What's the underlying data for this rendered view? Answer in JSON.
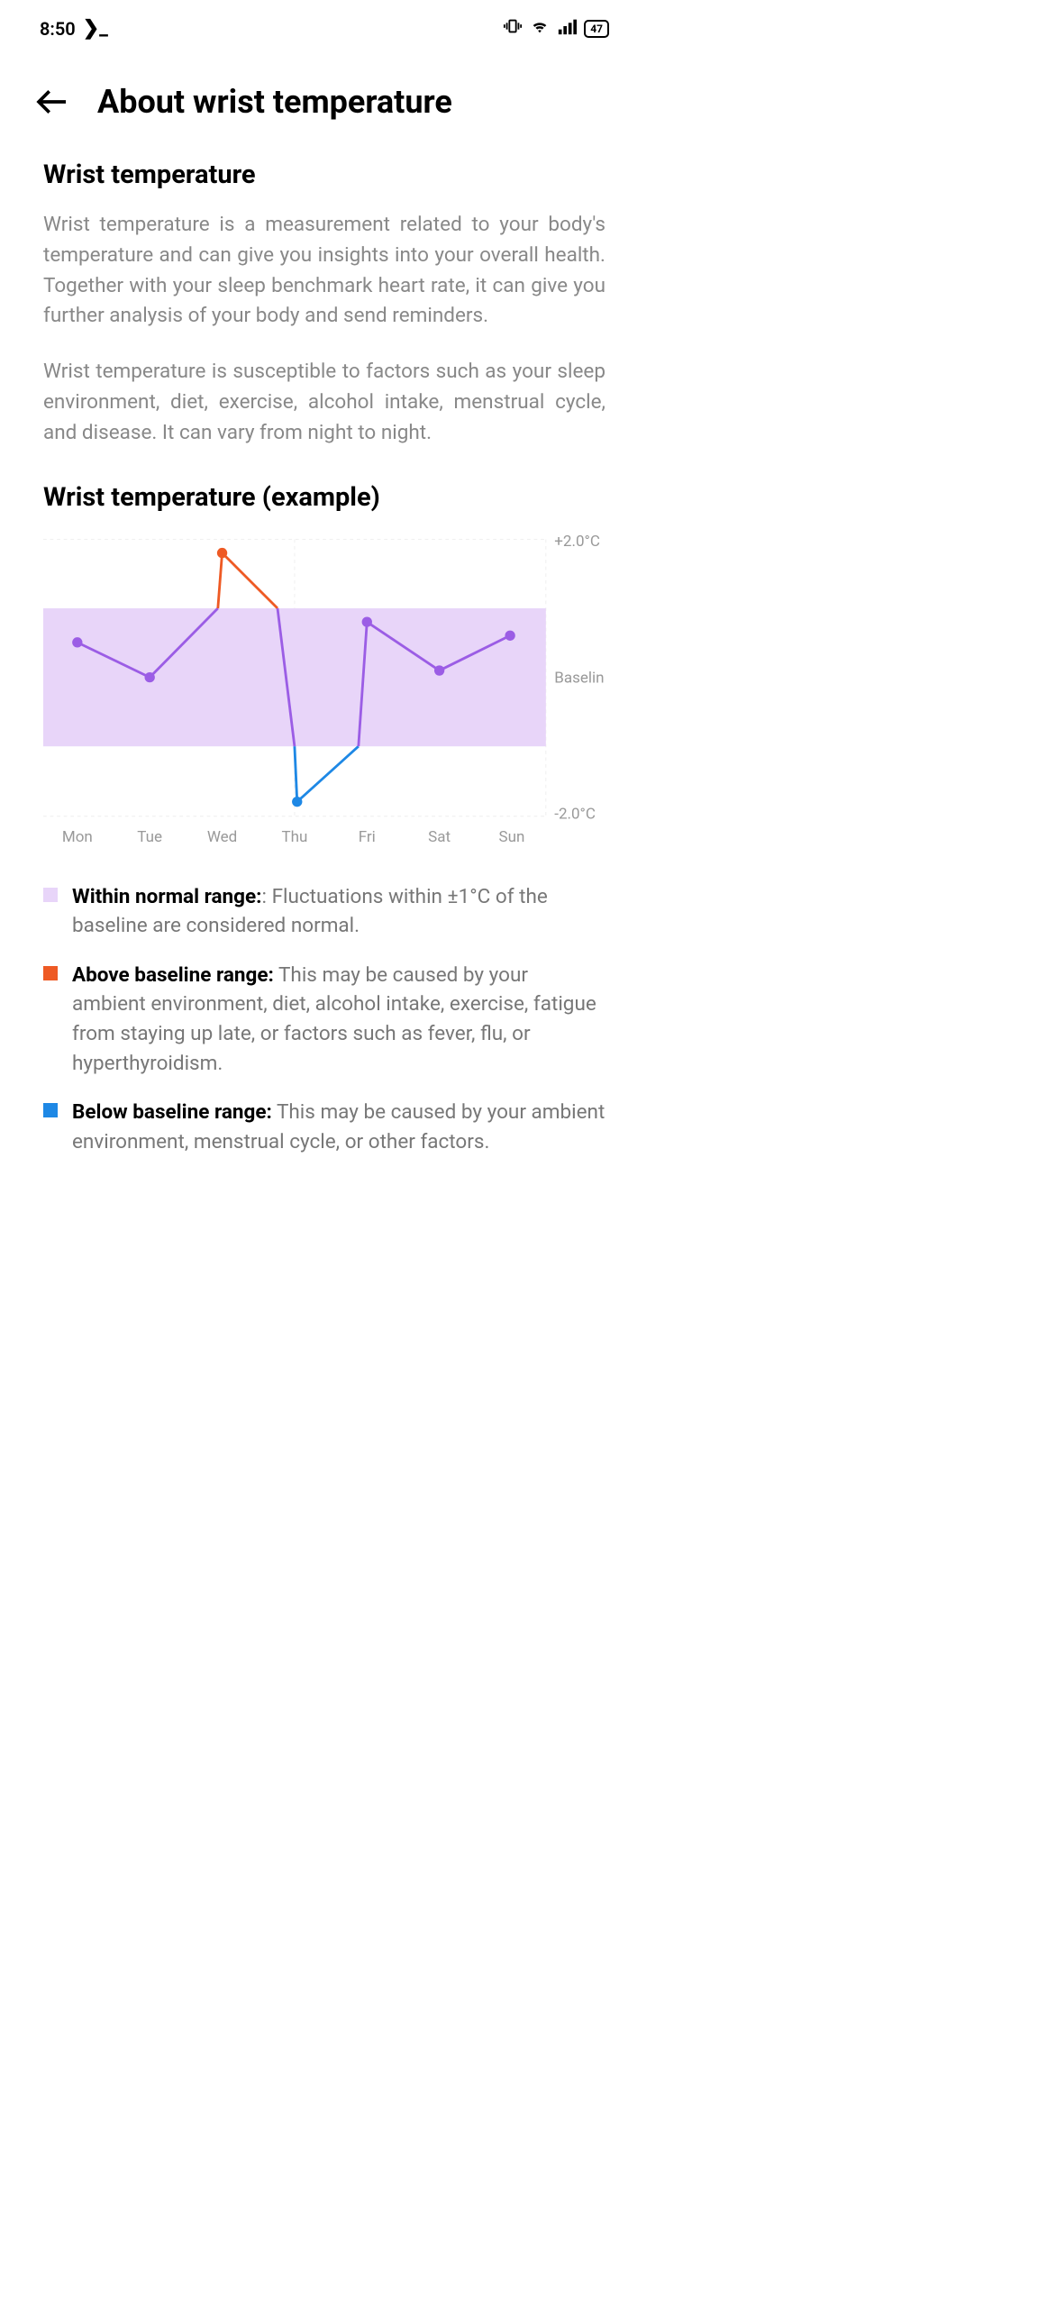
{
  "status": {
    "time": "8:50",
    "terminal": "❯_",
    "battery": "47"
  },
  "header": {
    "title": "About wrist temperature"
  },
  "section1": {
    "heading": "Wrist temperature",
    "p1": "Wrist temperature is a measurement related to your body's temperature and can give you insights into your overall health. Together with your sleep benchmark heart rate, it can give you further analysis of your body and send reminders.",
    "p2": "Wrist temperature is susceptible to factors such as your sleep environment, diet, exercise, alcohol intake, menstrual cycle, and disease. It can vary from night to night."
  },
  "section2": {
    "heading": "Wrist temperature (example)"
  },
  "chart_data": {
    "type": "line",
    "categories": [
      "Mon",
      "Tue",
      "Wed",
      "Thu",
      "Fri",
      "Sat",
      "Sun"
    ],
    "values": [
      0.5,
      0.0,
      1.8,
      -1.8,
      0.8,
      0.1,
      0.6
    ],
    "ylim": [
      -2.0,
      2.0
    ],
    "baseline": 0,
    "normal_range": [
      -1.0,
      1.0
    ],
    "ytick_top": "+2.0°C",
    "ytick_mid": "Baselin",
    "ytick_bottom": "-2.0°C",
    "colors": {
      "normal": "#9b5de5",
      "above": "#ee5a24",
      "below": "#1e88e5",
      "band": "#e8d5f9"
    }
  },
  "legend": {
    "normal": {
      "label": "Within normal range:",
      "sep": ":",
      "text": " Fluctuations within ±1°C of the baseline are considered normal."
    },
    "above": {
      "label": "Above baseline range:",
      "text": " This may be caused by your ambient environment, diet, alcohol intake, exercise, fatigue from staying up late, or factors such as fever, flu, or hyperthyroidism."
    },
    "below": {
      "label": "Below baseline range:",
      "text": " This may be caused by your ambient environment, menstrual cycle, or other factors."
    }
  }
}
